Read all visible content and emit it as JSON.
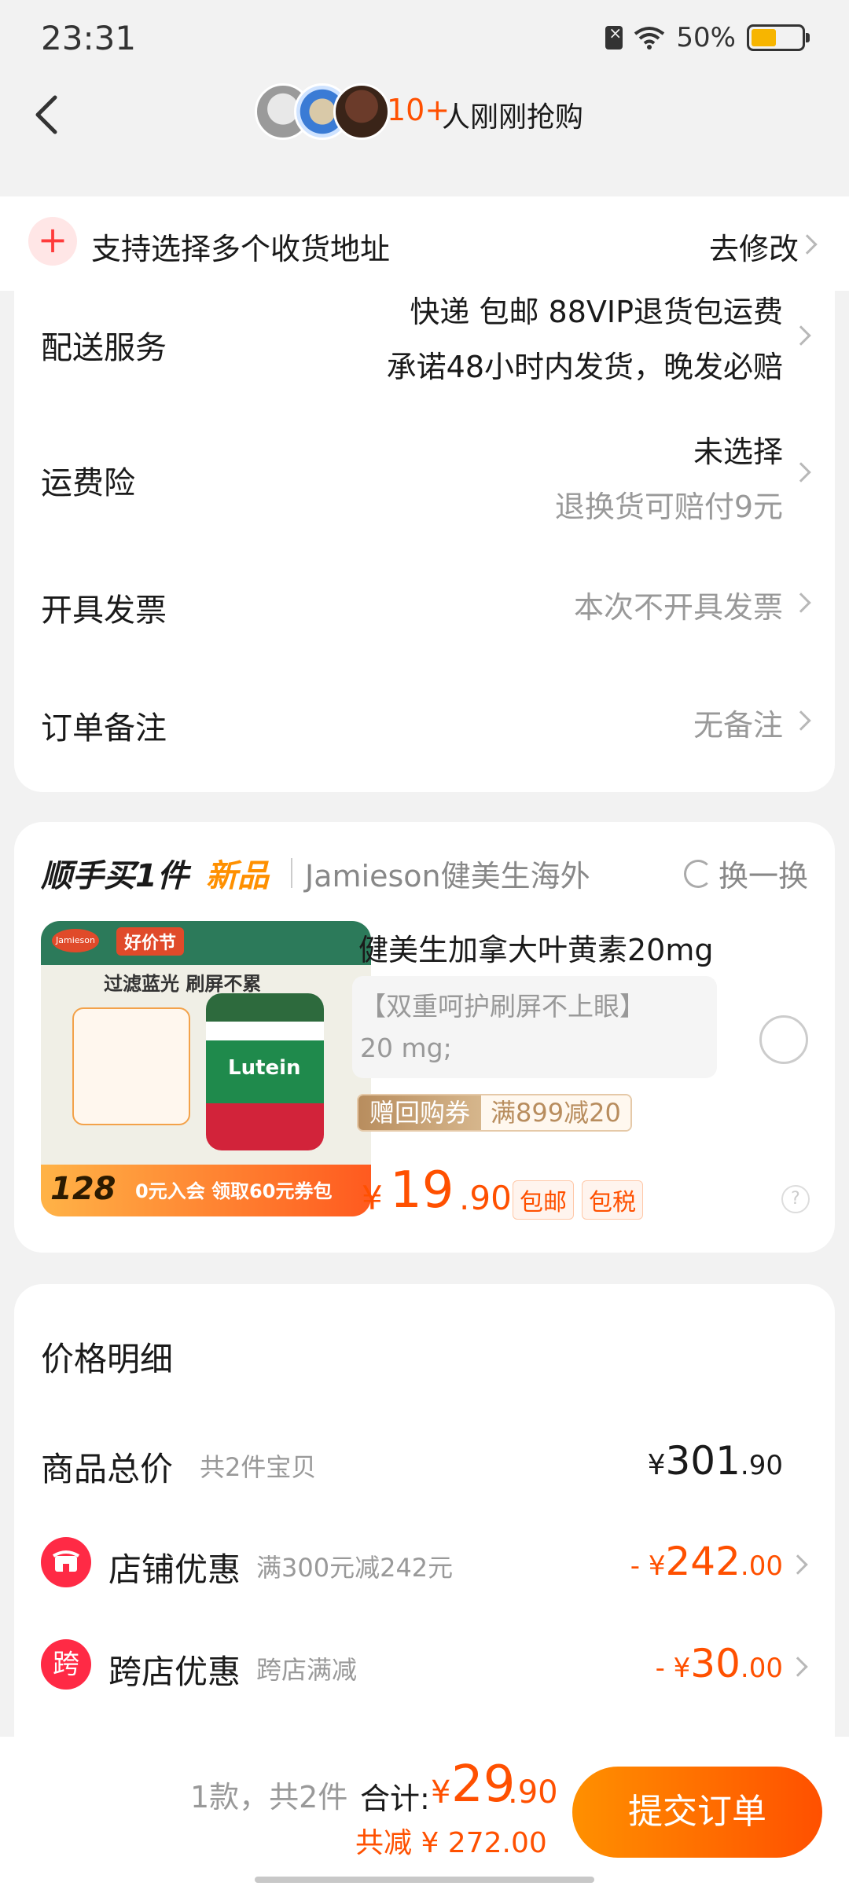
{
  "status": {
    "time": "23:31",
    "battery": "50%",
    "battery_level": 0.5
  },
  "nav": {
    "count": "10+",
    "text": "人刚刚抢购"
  },
  "address": {
    "text": "支持选择多个收货地址",
    "edit": "去修改"
  },
  "delivery": {
    "label": "配送服务",
    "line1": "快递 包邮 88VIP退货包运费",
    "line2": "承诺48小时内发货，晚发必赔"
  },
  "insurance": {
    "label": "运费险",
    "value": "未选择",
    "note": "退换货可赔付9元"
  },
  "invoice": {
    "label": "开具发票",
    "value": "本次不开具发票"
  },
  "remark": {
    "label": "订单备注",
    "value": "无备注"
  },
  "addon": {
    "title": "顺手买1件",
    "new": "新品",
    "shop": "Jamieson健美生海外",
    "swap": "换一换",
    "product": {
      "name": "健美生加拿大叶黄素20mg",
      "desc1": "【双重呵护刷屏不上眼】",
      "desc2": "20 mg;",
      "coupon_left": "赠回购券",
      "coupon_right": "满899减20",
      "price_sym": "¥",
      "price_int": "19",
      "price_dec": ".90",
      "badge1": "包邮",
      "badge2": "包税",
      "img": {
        "logo": "Jamieson",
        "tag": "好价节",
        "headline": "过滤蓝光 刷屏不累",
        "bottle": "Lutein",
        "price": "128",
        "coupon": "0元入会 领取60元券包"
      }
    }
  },
  "price_detail": {
    "title": "价格明细",
    "total": {
      "label": "商品总价",
      "sub": "共2件宝贝",
      "sym": "¥",
      "int": "301",
      "dec": ".90"
    },
    "shop_discount": {
      "label": "店铺优惠",
      "sub": "满300元减242元",
      "prefix": "- ¥",
      "int": "242",
      "dec": ".00"
    },
    "cross_discount": {
      "icon_text": "跨",
      "label": "跨店优惠",
      "sub": "跨店满减",
      "prefix": "- ¥",
      "int": "30",
      "dec": ".00"
    }
  },
  "bottom": {
    "count": "1款，共2件",
    "total_label": "合计:",
    "sym": "¥",
    "int": "29",
    "dec": ".90",
    "reduce": "共减 ¥ 272.00",
    "submit": "提交订单"
  },
  "colors": {
    "accent": "#ff5000",
    "addon_new": "#ff9000",
    "discount_icon": "#ff2a45"
  }
}
